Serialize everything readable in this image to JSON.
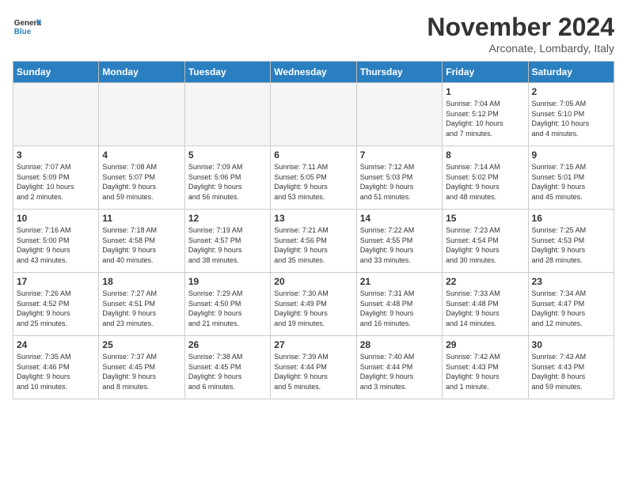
{
  "header": {
    "logo_general": "General",
    "logo_blue": "Blue",
    "month_title": "November 2024",
    "location": "Arconate, Lombardy, Italy"
  },
  "weekdays": [
    "Sunday",
    "Monday",
    "Tuesday",
    "Wednesday",
    "Thursday",
    "Friday",
    "Saturday"
  ],
  "weeks": [
    [
      {
        "day": "",
        "info": ""
      },
      {
        "day": "",
        "info": ""
      },
      {
        "day": "",
        "info": ""
      },
      {
        "day": "",
        "info": ""
      },
      {
        "day": "",
        "info": ""
      },
      {
        "day": "1",
        "info": "Sunrise: 7:04 AM\nSunset: 5:12 PM\nDaylight: 10 hours\nand 7 minutes."
      },
      {
        "day": "2",
        "info": "Sunrise: 7:05 AM\nSunset: 5:10 PM\nDaylight: 10 hours\nand 4 minutes."
      }
    ],
    [
      {
        "day": "3",
        "info": "Sunrise: 7:07 AM\nSunset: 5:09 PM\nDaylight: 10 hours\nand 2 minutes."
      },
      {
        "day": "4",
        "info": "Sunrise: 7:08 AM\nSunset: 5:07 PM\nDaylight: 9 hours\nand 59 minutes."
      },
      {
        "day": "5",
        "info": "Sunrise: 7:09 AM\nSunset: 5:06 PM\nDaylight: 9 hours\nand 56 minutes."
      },
      {
        "day": "6",
        "info": "Sunrise: 7:11 AM\nSunset: 5:05 PM\nDaylight: 9 hours\nand 53 minutes."
      },
      {
        "day": "7",
        "info": "Sunrise: 7:12 AM\nSunset: 5:03 PM\nDaylight: 9 hours\nand 51 minutes."
      },
      {
        "day": "8",
        "info": "Sunrise: 7:14 AM\nSunset: 5:02 PM\nDaylight: 9 hours\nand 48 minutes."
      },
      {
        "day": "9",
        "info": "Sunrise: 7:15 AM\nSunset: 5:01 PM\nDaylight: 9 hours\nand 45 minutes."
      }
    ],
    [
      {
        "day": "10",
        "info": "Sunrise: 7:16 AM\nSunset: 5:00 PM\nDaylight: 9 hours\nand 43 minutes."
      },
      {
        "day": "11",
        "info": "Sunrise: 7:18 AM\nSunset: 4:58 PM\nDaylight: 9 hours\nand 40 minutes."
      },
      {
        "day": "12",
        "info": "Sunrise: 7:19 AM\nSunset: 4:57 PM\nDaylight: 9 hours\nand 38 minutes."
      },
      {
        "day": "13",
        "info": "Sunrise: 7:21 AM\nSunset: 4:56 PM\nDaylight: 9 hours\nand 35 minutes."
      },
      {
        "day": "14",
        "info": "Sunrise: 7:22 AM\nSunset: 4:55 PM\nDaylight: 9 hours\nand 33 minutes."
      },
      {
        "day": "15",
        "info": "Sunrise: 7:23 AM\nSunset: 4:54 PM\nDaylight: 9 hours\nand 30 minutes."
      },
      {
        "day": "16",
        "info": "Sunrise: 7:25 AM\nSunset: 4:53 PM\nDaylight: 9 hours\nand 28 minutes."
      }
    ],
    [
      {
        "day": "17",
        "info": "Sunrise: 7:26 AM\nSunset: 4:52 PM\nDaylight: 9 hours\nand 25 minutes."
      },
      {
        "day": "18",
        "info": "Sunrise: 7:27 AM\nSunset: 4:51 PM\nDaylight: 9 hours\nand 23 minutes."
      },
      {
        "day": "19",
        "info": "Sunrise: 7:29 AM\nSunset: 4:50 PM\nDaylight: 9 hours\nand 21 minutes."
      },
      {
        "day": "20",
        "info": "Sunrise: 7:30 AM\nSunset: 4:49 PM\nDaylight: 9 hours\nand 19 minutes."
      },
      {
        "day": "21",
        "info": "Sunrise: 7:31 AM\nSunset: 4:48 PM\nDaylight: 9 hours\nand 16 minutes."
      },
      {
        "day": "22",
        "info": "Sunrise: 7:33 AM\nSunset: 4:48 PM\nDaylight: 9 hours\nand 14 minutes."
      },
      {
        "day": "23",
        "info": "Sunrise: 7:34 AM\nSunset: 4:47 PM\nDaylight: 9 hours\nand 12 minutes."
      }
    ],
    [
      {
        "day": "24",
        "info": "Sunrise: 7:35 AM\nSunset: 4:46 PM\nDaylight: 9 hours\nand 10 minutes."
      },
      {
        "day": "25",
        "info": "Sunrise: 7:37 AM\nSunset: 4:45 PM\nDaylight: 9 hours\nand 8 minutes."
      },
      {
        "day": "26",
        "info": "Sunrise: 7:38 AM\nSunset: 4:45 PM\nDaylight: 9 hours\nand 6 minutes."
      },
      {
        "day": "27",
        "info": "Sunrise: 7:39 AM\nSunset: 4:44 PM\nDaylight: 9 hours\nand 5 minutes."
      },
      {
        "day": "28",
        "info": "Sunrise: 7:40 AM\nSunset: 4:44 PM\nDaylight: 9 hours\nand 3 minutes."
      },
      {
        "day": "29",
        "info": "Sunrise: 7:42 AM\nSunset: 4:43 PM\nDaylight: 9 hours\nand 1 minute."
      },
      {
        "day": "30",
        "info": "Sunrise: 7:43 AM\nSunset: 4:43 PM\nDaylight: 8 hours\nand 59 minutes."
      }
    ]
  ]
}
